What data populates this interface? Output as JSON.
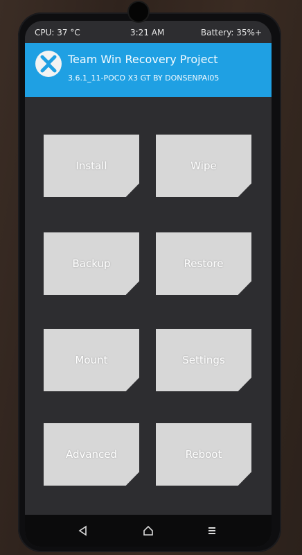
{
  "status_bar": {
    "cpu": "CPU: 37 °C",
    "time": "3:21 AM",
    "battery": "Battery: 35%+"
  },
  "header": {
    "title": "Team Win Recovery Project",
    "subtitle": "3.6.1_11-POCO X3 GT BY DONSENPAI05",
    "logo_icon": "twrp-logo-icon"
  },
  "menu": {
    "install": "Install",
    "wipe": "Wipe",
    "backup": "Backup",
    "restore": "Restore",
    "mount": "Mount",
    "settings": "Settings",
    "advanced": "Advanced",
    "reboot": "Reboot"
  },
  "nav": {
    "back_icon": "back-triangle-icon",
    "home_icon": "home-icon",
    "menu_icon": "menu-lines-icon"
  },
  "colors": {
    "accent": "#1fa0e3",
    "button": "#d7d7d7",
    "screen_bg": "#2d2d30"
  }
}
